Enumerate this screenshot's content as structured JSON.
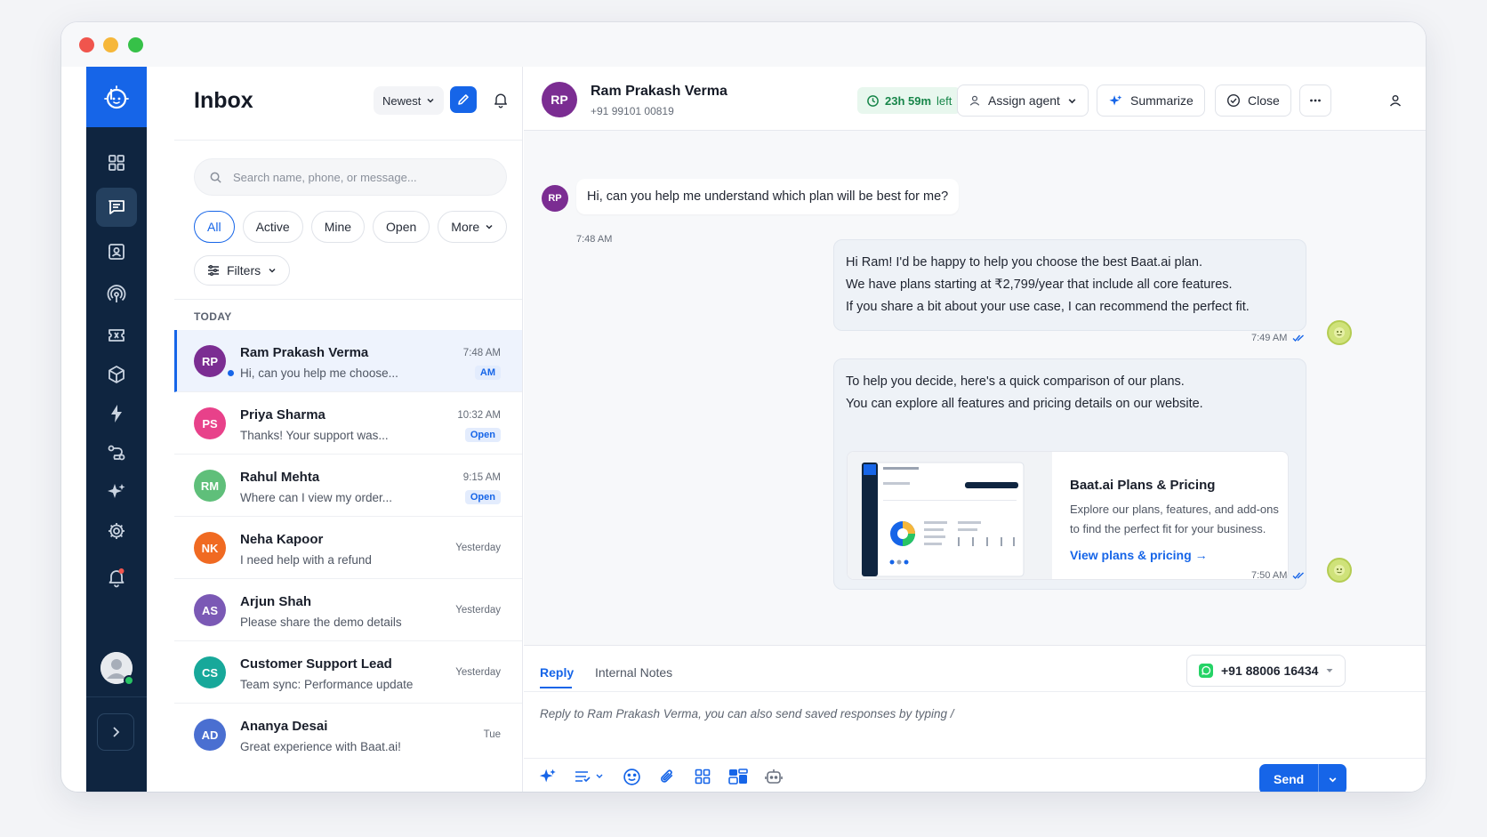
{
  "inbox": {
    "title": "Inbox",
    "sort_label": "Newest",
    "search_placeholder": "Search name, phone, or message...",
    "chips": [
      "All",
      "Active",
      "Mine",
      "Open",
      "More"
    ],
    "filters_label": "Filters",
    "section_label": "TODAY",
    "conversations": [
      {
        "initials": "RP",
        "name": "Ram Prakash Verma",
        "preview": "Hi, can you help me choose...",
        "time": "7:48 AM",
        "badge": "AM",
        "color": "#7b2d92"
      },
      {
        "initials": "PS",
        "name": "Priya Sharma",
        "preview": "Thanks! Your support was...",
        "time": "10:32 AM",
        "badge": "Open",
        "color": "#e8418a"
      },
      {
        "initials": "RM",
        "name": "Rahul Mehta",
        "preview": "Where can I view my order...",
        "time": "9:15 AM",
        "badge": "Open",
        "color": "#5fbf7a"
      },
      {
        "initials": "NK",
        "name": "Neha Kapoor",
        "preview": "I need help with a refund",
        "time": "Yesterday",
        "badge": "",
        "color": "#f06a22"
      },
      {
        "initials": "AS",
        "name": "Arjun Shah",
        "preview": "Please share the demo details",
        "time": "Yesterday",
        "badge": "",
        "color": "#7b59b5"
      },
      {
        "initials": "CS",
        "name": "Customer Support Lead",
        "preview": "Team sync: Performance update",
        "time": "Yesterday",
        "badge": "",
        "color": "#17a89a"
      },
      {
        "initials": "AD",
        "name": "Ananya Desai",
        "preview": "Great experience with Baat.ai!",
        "time": "Tue",
        "badge": "",
        "color": "#4a6fd1"
      }
    ]
  },
  "chat": {
    "contact_initials": "RP",
    "contact_name": "Ram Prakash Verma",
    "contact_phone": "+91 99101 00819",
    "timer_value": "23h 59m",
    "timer_suffix": "left",
    "assign_label": "Assign agent",
    "summarize_label": "Summarize",
    "close_label": "Close",
    "incoming": {
      "text": "Hi, can you help me understand which plan will be best for me?",
      "time": "7:48 AM"
    },
    "outgoing_1": {
      "lines": [
        "Hi Ram! I'd be happy to help you choose the best Baat.ai plan.",
        "We have plans starting at ₹2,799/year that include all core features.",
        "If you share a bit about your use case, I can recommend the perfect fit."
      ],
      "time": "7:49 AM"
    },
    "outgoing_2": {
      "lines": [
        "To help you decide, here's a quick comparison of our plans.",
        "You can explore all features and pricing details on our website."
      ],
      "time": "7:50 AM",
      "card_title": "Baat.ai Plans & Pricing",
      "card_desc": "Explore our plans, features, and add-ons to find the perfect fit for your business.",
      "card_link": "View plans & pricing"
    }
  },
  "composer": {
    "tab_reply": "Reply",
    "tab_notes": "Internal Notes",
    "channel_number": "+91 88006 16434",
    "placeholder": "Reply to Ram Prakash Verma, you can also send saved responses by typing /",
    "send_label": "Send"
  },
  "colors": {
    "brand": "#1665e8",
    "rail": "#0f2540",
    "timer_green": "#18864a"
  },
  "icons": [
    "grid-icon",
    "chat-icon",
    "contacts-icon",
    "broadcast-icon",
    "ticket-icon",
    "package-icon",
    "bolt-icon",
    "flow-icon",
    "sparkle-icon",
    "gear-icon",
    "bell-icon"
  ]
}
